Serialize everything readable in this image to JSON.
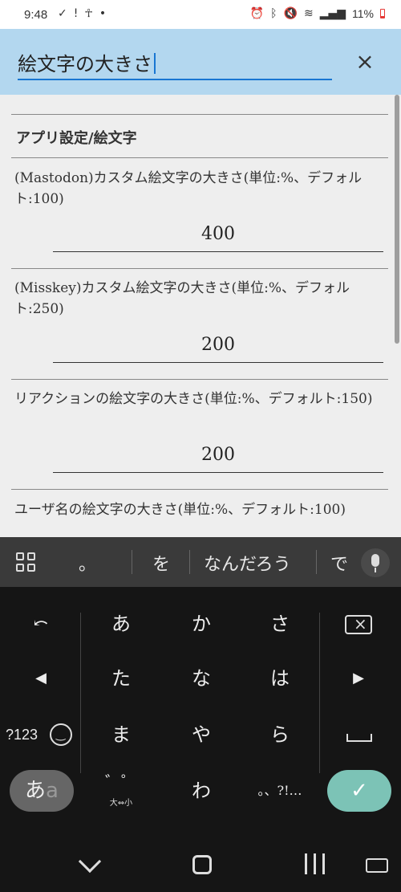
{
  "status_bar": {
    "time": "9:48",
    "battery": "11%"
  },
  "header": {
    "search_value": "絵文字の大きさ",
    "close_icon": "×"
  },
  "content": {
    "section_title": "アプリ設定/絵文字",
    "settings": [
      {
        "label": "(Mastodon)カスタム絵文字の大きさ(単位:%、デフォルト:100)",
        "value": "400"
      },
      {
        "label": "(Misskey)カスタム絵文字の大きさ(単位:%、デフォルト:250)",
        "value": "200"
      },
      {
        "label": "リアクションの絵文字の大きさ(単位:%、デフォルト:150)",
        "value": "200"
      },
      {
        "label": "ユーザ名の絵文字の大きさ(単位:%、デフォルト:100)",
        "value": ""
      }
    ]
  },
  "suggestions": {
    "items": [
      "。",
      "を",
      "なんだろう",
      "で"
    ]
  },
  "keyboard": {
    "row1": [
      "あ",
      "か",
      "さ"
    ],
    "row2": [
      "た",
      "な",
      "は"
    ],
    "row3": [
      "ま",
      "や",
      "ら"
    ],
    "row4": [
      "わ"
    ],
    "undo_symbol": "⤺",
    "left_arrow": "◀",
    "right_arrow": "▶",
    "num_mode": "?123",
    "kana_toggle_main": "あ",
    "kana_toggle_sub": "a",
    "dakuten_label": "大⇔小",
    "punct_label": "。、?!…",
    "enter_symbol": "✓"
  }
}
